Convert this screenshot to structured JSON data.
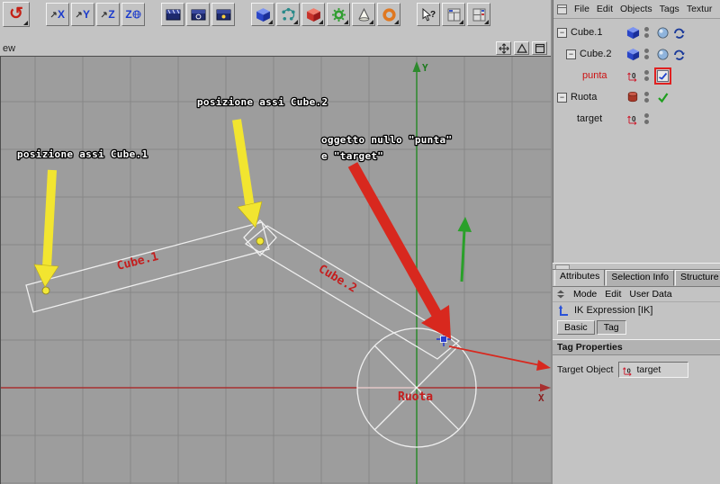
{
  "colors": {
    "accent_yellow": "#f2e530",
    "accent_red": "#d8281e",
    "axis_green": "#2d8a2d",
    "axis_red": "#a83030",
    "selection_red": "#cc1111"
  },
  "toolbar": {
    "undo": {
      "icon": "undo-icon"
    },
    "axis_x": {
      "label": "X",
      "icon": "axis-x-lock-icon"
    },
    "axis_y": {
      "label": "Y",
      "icon": "axis-y-lock-icon"
    },
    "axis_z": {
      "label": "Z",
      "icon": "axis-z-lock-icon"
    },
    "coord": {
      "label": "Z",
      "icon": "coordinate-system-icon"
    },
    "help": {
      "label": "?",
      "icon": "help-pointer-icon"
    }
  },
  "viewport": {
    "menu_label": "ew",
    "axis_x_label": "X",
    "axis_y_label": "Y",
    "object_labels": {
      "cube1": "Cube.1",
      "cube2": "Cube.2",
      "ruota": "Ruota"
    },
    "annotations": {
      "cube1_axis": "posizione assi Cube.1",
      "cube2_axis": "posizione assi Cube.2",
      "null_line1": "oggetto nullo \"punta\"",
      "null_line2": "e \"target\""
    }
  },
  "object_manager": {
    "menu": [
      "File",
      "Edit",
      "Objects",
      "Tags",
      "Textur"
    ],
    "null_icon_label": "0",
    "objects": [
      {
        "name": "Cube.1"
      },
      {
        "name": "Cube.2"
      },
      {
        "name": "punta"
      },
      {
        "name": "Ruota"
      },
      {
        "name": "target"
      }
    ]
  },
  "attributes_manager": {
    "tabs": [
      "Attributes",
      "Selection Info",
      "Structure In"
    ],
    "menu": [
      "Mode",
      "Edit",
      "User Data"
    ],
    "title": "IK Expression [IK]",
    "page_tabs": [
      "Basic",
      "Tag"
    ],
    "section": "Tag Properties",
    "field": {
      "label": "Target Object",
      "value": "target"
    }
  }
}
